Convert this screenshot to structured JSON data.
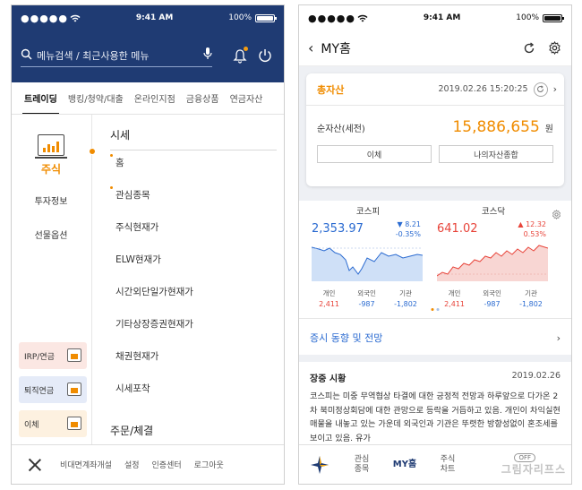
{
  "left": {
    "status": {
      "signal": "●●●●●",
      "time": "9:41 AM",
      "battery": "100%"
    },
    "search": {
      "placeholder": "메뉴검색 / 최근사용한 메뉴"
    },
    "tabs": [
      {
        "label": "트레이딩"
      },
      {
        "label": "뱅킹/청약/대출"
      },
      {
        "label": "온라인지점"
      },
      {
        "label": "금융상품"
      },
      {
        "label": "연금자산"
      }
    ],
    "sidebar": {
      "items": [
        {
          "label": "주식"
        },
        {
          "label": "투자정보"
        },
        {
          "label": "선물옵션"
        }
      ],
      "cards": [
        {
          "label": "IRP/연금",
          "color": "#fbe7e3"
        },
        {
          "label": "퇴직연금",
          "color": "#e5ebf8"
        },
        {
          "label": "이체",
          "color": "#fdf1e0"
        }
      ]
    },
    "sections": [
      {
        "title": "시세"
      },
      {
        "title": "주문/체결"
      }
    ],
    "menu_items": [
      {
        "label": "홈"
      },
      {
        "label": "관심종목"
      },
      {
        "label": "주식현재가"
      },
      {
        "label": "ELW현재가"
      },
      {
        "label": "시간외단일가현재가"
      },
      {
        "label": "기타상장증권현재가"
      },
      {
        "label": "채권현재가"
      },
      {
        "label": "시세포착"
      }
    ],
    "bottom": [
      {
        "label": "비대면계좌개설"
      },
      {
        "label": "설정"
      },
      {
        "label": "인증센터"
      },
      {
        "label": "로그아웃"
      }
    ]
  },
  "right": {
    "status": {
      "signal": "●●●●●",
      "time": "9:41 AM",
      "battery": "100%"
    },
    "header": {
      "back": "‹",
      "title": "MY홈"
    },
    "asset": {
      "title": "총자산",
      "date": "2019.02.26 15:20:25",
      "label": "순자산(세전)",
      "value": "15,886,655",
      "unit": "원",
      "btn1": "이체",
      "btn2": "나의자산종합"
    },
    "indices": [
      {
        "name": "코스피",
        "value": "2,353.97",
        "change": "8.21",
        "pct": "-0.35%",
        "dir": "▼",
        "color": "#2b6bd1",
        "fill": "#cfe0f7",
        "investors": [
          {
            "label": "개인",
            "value": "2,411"
          },
          {
            "label": "외국인",
            "value": "-987"
          },
          {
            "label": "기관",
            "value": "-1,802"
          }
        ]
      },
      {
        "name": "코스닥",
        "value": "641.02",
        "change": "12.32",
        "pct": "0.53%",
        "dir": "▲",
        "color": "#e8443a",
        "fill": "#f8d6d3",
        "investors": [
          {
            "label": "개인",
            "value": "2,411"
          },
          {
            "label": "외국인",
            "value": "-987"
          },
          {
            "label": "기관",
            "value": "-1,802"
          }
        ]
      }
    ],
    "news": {
      "section": "증시 동향 및 전망",
      "title": "장중 시황",
      "date": "2019.02.26",
      "text": "코스피는 미중 무역협상 타결에 대한 긍정적 전망과 하루앞으로 다가온 2차 북미정상회담에 대한 관망으로 등락을 거듭하고 있음. 개인이 차익실현 매물을 내놓고 있는 가운데 외국인과 기관은 뚜렷한 방향성없이 혼조세를 보이고 있음. 유가"
    },
    "bottom": [
      {
        "label": "관심\n종목"
      },
      {
        "label": "MY홈"
      },
      {
        "label": "주식\n차트"
      },
      {
        "label": "OFF"
      }
    ],
    "watermark": "그림자리프스"
  }
}
